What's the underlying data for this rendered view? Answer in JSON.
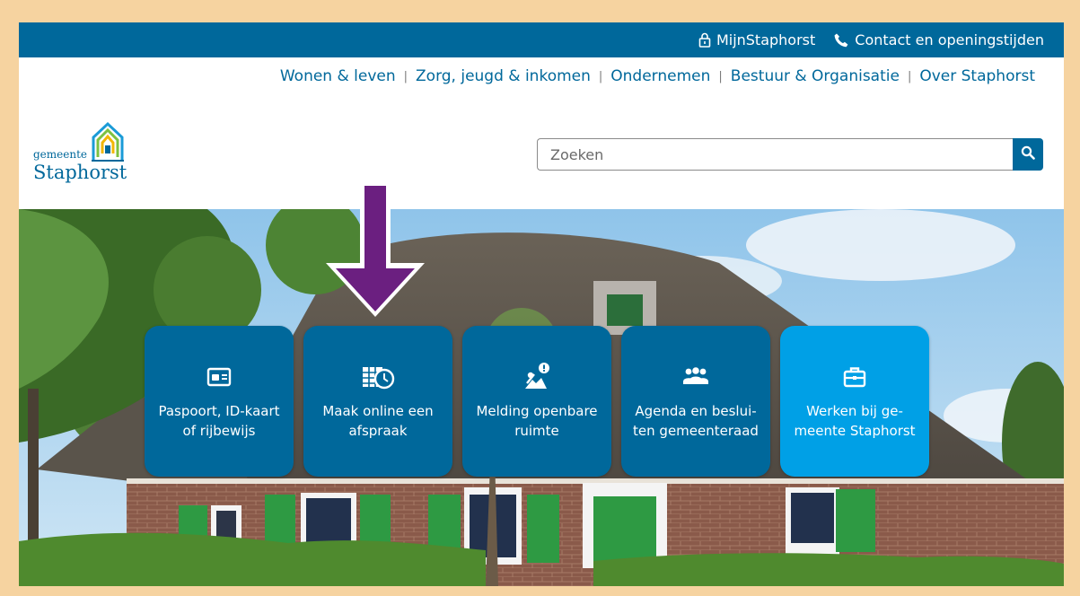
{
  "topbar": {
    "links": [
      {
        "label": "MijnStaphorst",
        "icon": "lock-icon"
      },
      {
        "label": "Contact en openingstijden",
        "icon": "phone-icon"
      }
    ]
  },
  "nav": {
    "items": [
      "Wonen & leven",
      "Zorg, jeugd & inkomen",
      "Ondernemen",
      "Bestuur & Organisatie",
      "Over Staphorst"
    ],
    "separator": "|"
  },
  "logo": {
    "line1": "gemeente",
    "line2": "Staphorst"
  },
  "search": {
    "placeholder": "Zoeken",
    "button_icon": "search-icon"
  },
  "tiles": [
    {
      "line1": "Paspoort, ID-kaart",
      "line2": "of rijbewijs",
      "icon": "id-card-icon",
      "color": "#00689b"
    },
    {
      "line1": "Maak online een",
      "line2": "afspraak",
      "icon": "calendar-clock-icon",
      "color": "#00689b"
    },
    {
      "line1": "Melding openbare",
      "line2": "ruimte",
      "icon": "report-issue-icon",
      "color": "#00689b"
    },
    {
      "line1": "Agenda en beslui-",
      "line2": "ten gemeenteraad",
      "icon": "people-icon",
      "color": "#00689b"
    },
    {
      "line1": "Werken bij ge-",
      "line2": "meente Staphorst",
      "icon": "briefcase-icon",
      "color": "#00a0e6"
    }
  ],
  "annotation": {
    "icon": "down-arrow-icon",
    "color": "#6b1f80"
  },
  "colors": {
    "brand": "#00689b",
    "accent": "#00a0e6",
    "frame": "#f6d3a0"
  }
}
